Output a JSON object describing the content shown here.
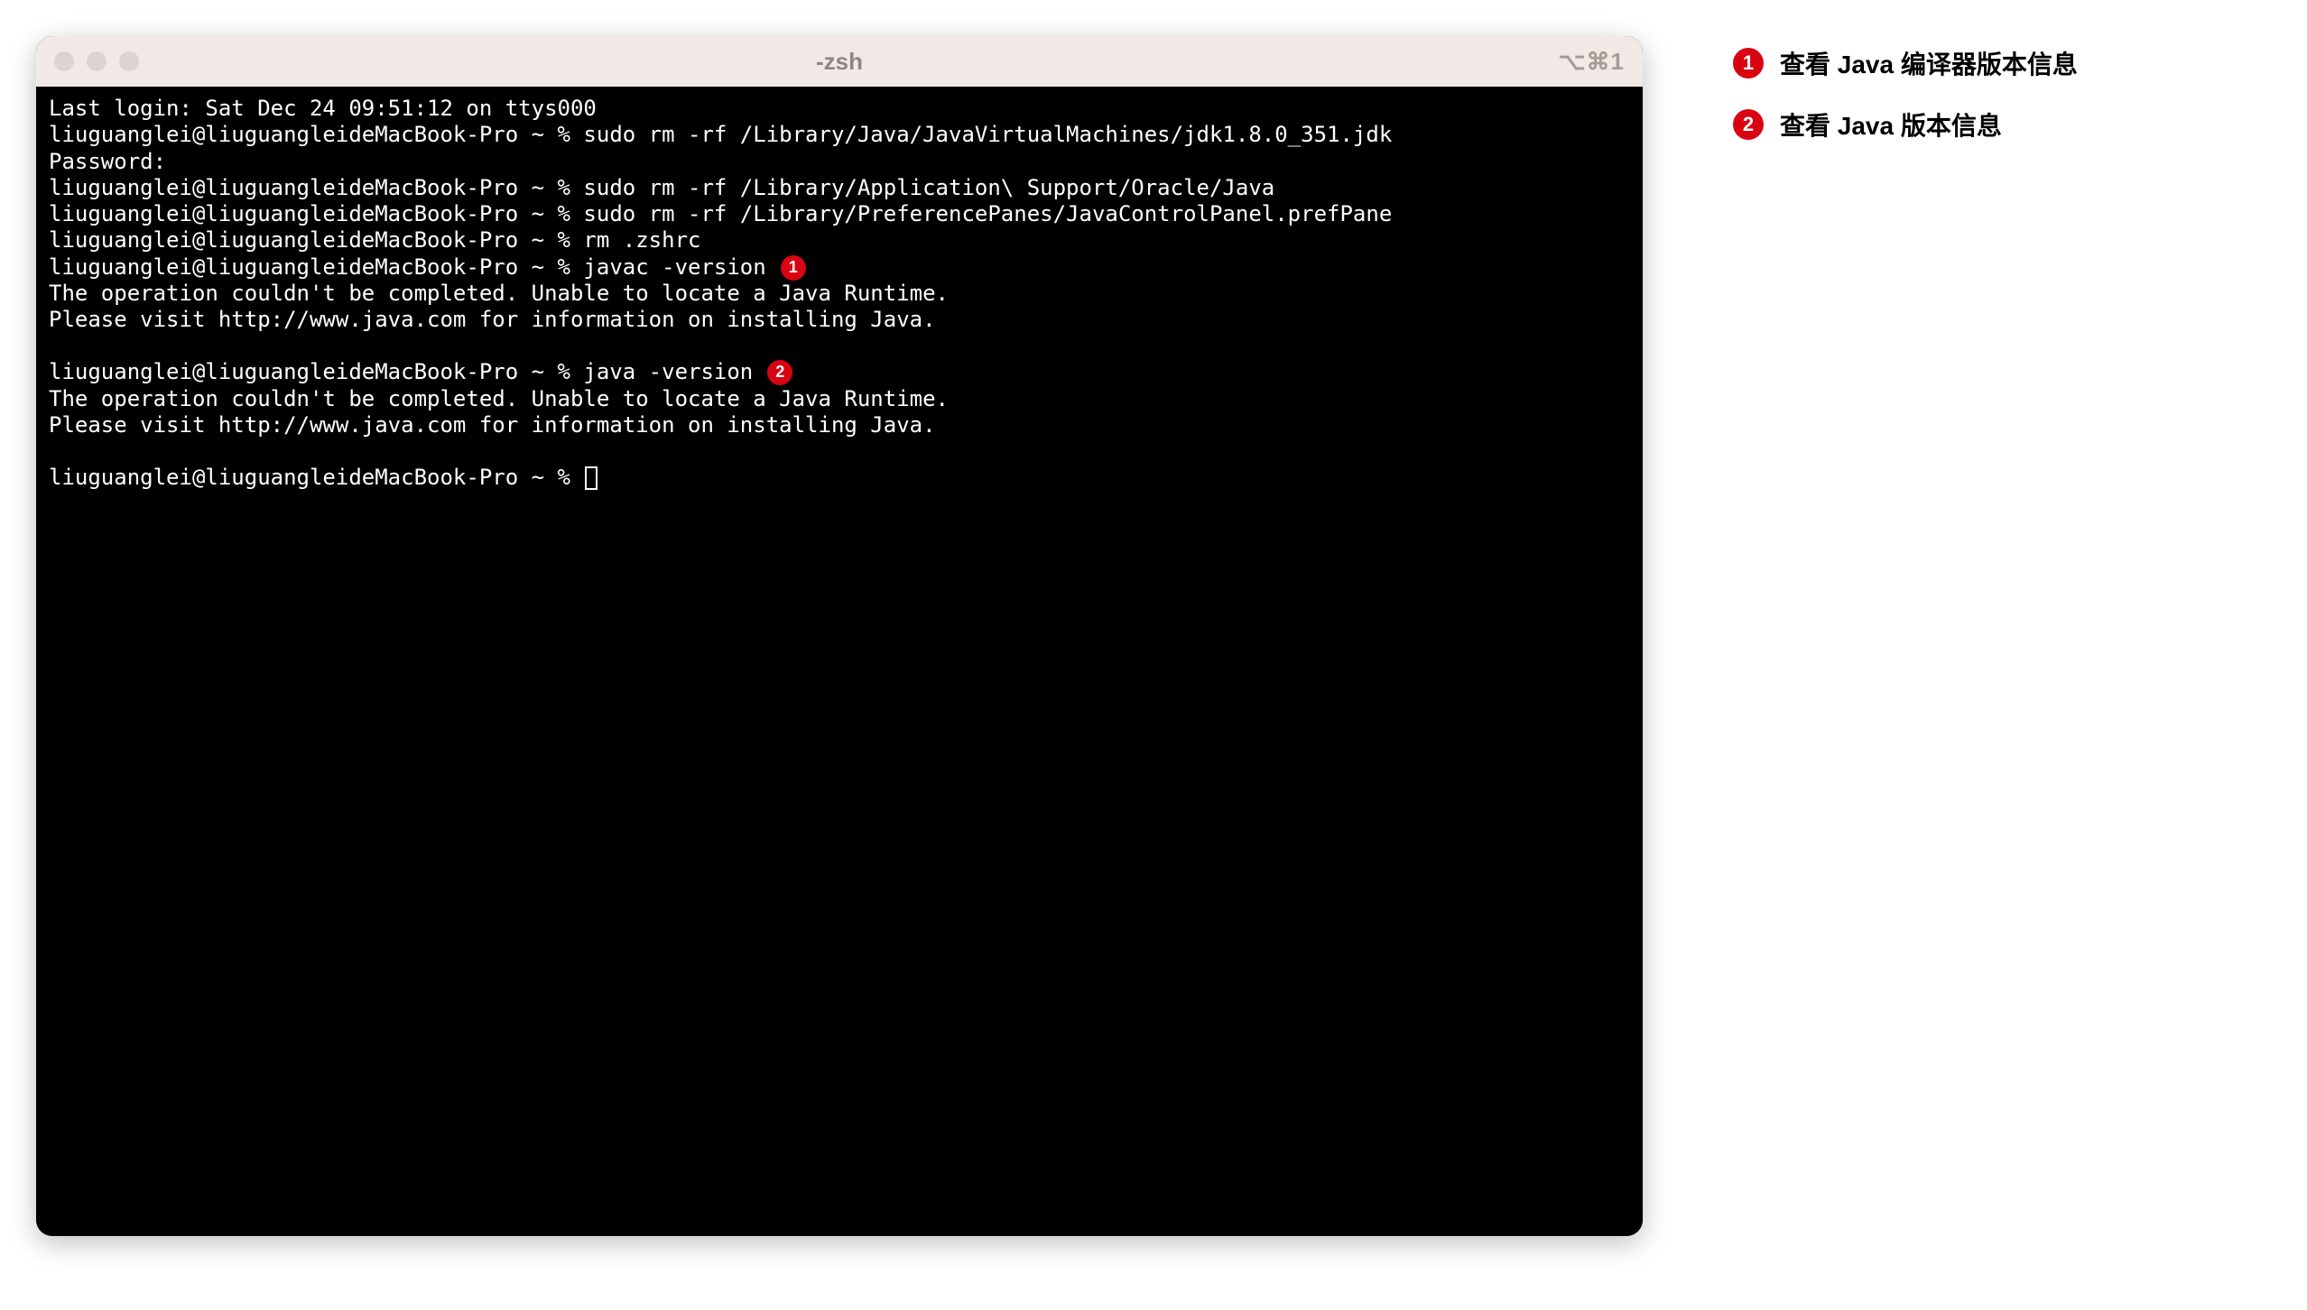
{
  "window": {
    "title": "-zsh",
    "shortcut_indicator": "⌥⌘1"
  },
  "terminal": {
    "lines": [
      {
        "text": "Last login: Sat Dec 24 09:51:12 on ttys000",
        "badge": null
      },
      {
        "text": "liuguanglei@liuguangleideMacBook-Pro ~ % sudo rm -rf /Library/Java/JavaVirtualMachines/jdk1.8.0_351.jdk",
        "badge": null
      },
      {
        "text": "Password:",
        "badge": null
      },
      {
        "text": "liuguanglei@liuguangleideMacBook-Pro ~ % sudo rm -rf /Library/Application\\ Support/Oracle/Java",
        "badge": null
      },
      {
        "text": "liuguanglei@liuguangleideMacBook-Pro ~ % sudo rm -rf /Library/PreferencePanes/JavaControlPanel.prefPane",
        "badge": null
      },
      {
        "text": "liuguanglei@liuguangleideMacBook-Pro ~ % rm .zshrc",
        "badge": null
      },
      {
        "text": "liuguanglei@liuguangleideMacBook-Pro ~ % javac -version",
        "badge": 1
      },
      {
        "text": "The operation couldn't be completed. Unable to locate a Java Runtime.",
        "badge": null
      },
      {
        "text": "Please visit http://www.java.com for information on installing Java.",
        "badge": null
      },
      {
        "text": "",
        "badge": null
      },
      {
        "text": "liuguanglei@liuguangleideMacBook-Pro ~ % java -version",
        "badge": 2
      },
      {
        "text": "The operation couldn't be completed. Unable to locate a Java Runtime.",
        "badge": null
      },
      {
        "text": "Please visit http://www.java.com for information on installing Java.",
        "badge": null
      },
      {
        "text": "",
        "badge": null
      },
      {
        "text": "liuguanglei@liuguangleideMacBook-Pro ~ % ",
        "badge": null,
        "cursor": true
      }
    ]
  },
  "annotations": [
    {
      "num": 1,
      "label": "查看 Java 编译器版本信息"
    },
    {
      "num": 2,
      "label": "查看 Java 版本信息"
    }
  ]
}
